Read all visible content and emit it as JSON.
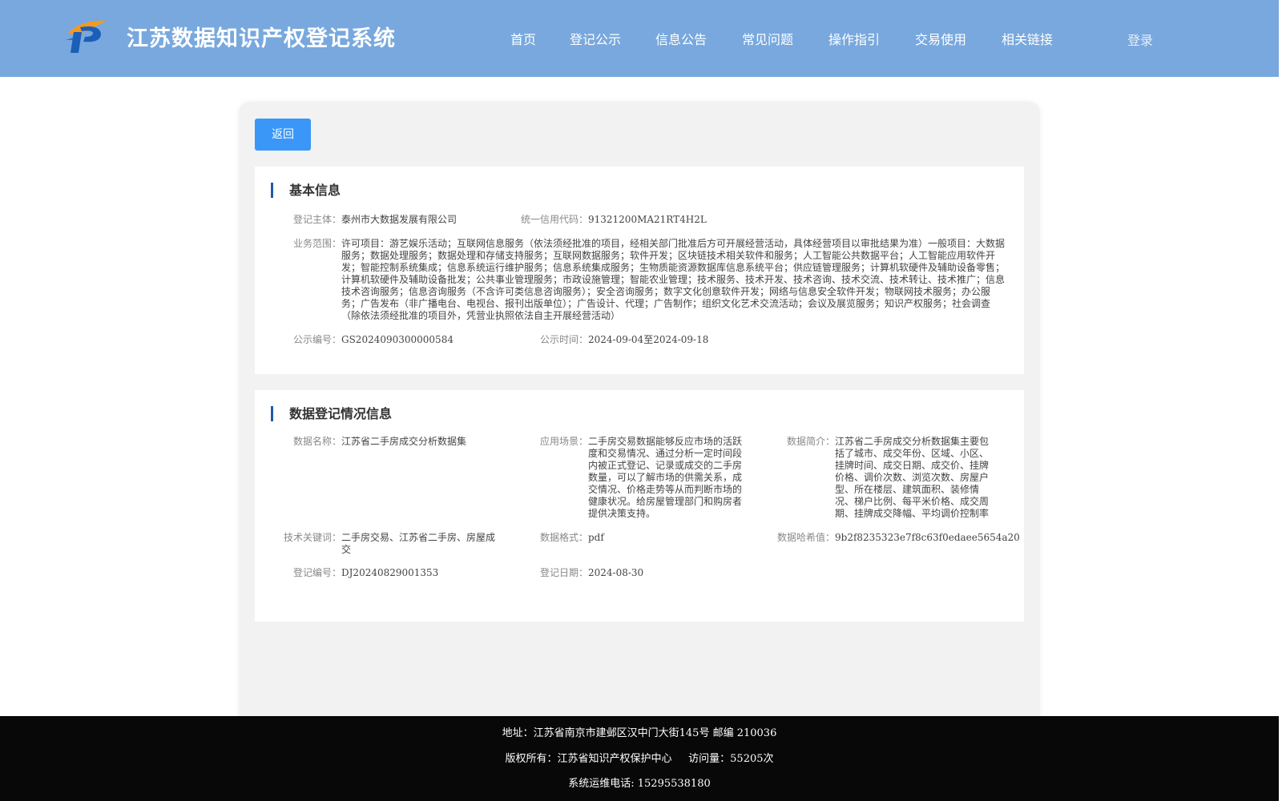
{
  "header": {
    "title": "江苏数据知识产权登记系统",
    "nav": [
      "首页",
      "登记公示",
      "信息公告",
      "常见问题",
      "操作指引",
      "交易使用",
      "相关链接"
    ],
    "login": "登录",
    "bg_color": "#78a8de"
  },
  "back_button": "返回",
  "basic": {
    "section_title": "基本信息",
    "subject_label": "登记主体：",
    "subject_value": "泰州市大数据发展有限公司",
    "credit_label": "统一信用代码：",
    "credit_value": "91321200MA21RT4H2L",
    "scope_label": "业务范围：",
    "scope_value": "许可项目：游艺娱乐活动；互联网信息服务（依法须经批准的项目，经相关部门批准后方可开展经营活动，具体经营项目以审批结果为准）一般项目：大数据服务；数据处理服务；数据处理和存储支持服务；互联网数据服务；软件开发；区块链技术相关软件和服务；人工智能公共数据平台；人工智能应用软件开发；智能控制系统集成；信息系统运行维护服务；信息系统集成服务；生物质能资源数据库信息系统平台；供应链管理服务；计算机软硬件及辅助设备零售；计算机软硬件及辅助设备批发；公共事业管理服务；市政设施管理；智能农业管理；技术服务、技术开发、技术咨询、技术交流、技术转让、技术推广；信息技术咨询服务；信息咨询服务（不含许可类信息咨询服务）；安全咨询服务；数字文化创意软件开发；网络与信息安全软件开发；物联网技术服务；办公服务；广告发布（非广播电台、电视台、报刊出版单位）；广告设计、代理；广告制作；组织文化艺术交流活动；会议及展览服务；知识产权服务；社会调查（除依法须经批准的项目外，凭营业执照依法自主开展经营活动）",
    "pub_no_label": "公示编号：",
    "pub_no_value": "GS2024090300000584",
    "pub_time_label": "公示时间：",
    "pub_time_value": "2024-09-04至2024-09-18"
  },
  "data_reg": {
    "section_title": "数据登记情况信息",
    "name_label": "数据名称：",
    "name_value": "江苏省二手房成交分析数据集",
    "scene_label": "应用场景：",
    "scene_value": "二手房交易数据能够反应市场的活跃度和交易情况、通过分析一定时间段内被正式登记、记录或成交的二手房数量，可以了解市场的供需关系，成交情况、价格走势等从而判断市场的健康状况。给房屋管理部门和购房者提供决策支持。",
    "intro_label": "数据简介：",
    "intro_value": "江苏省二手房成交分析数据集主要包括了城市、成交年份、区域、小区、挂牌时间、成交日期、成交价、挂牌价格、调价次数、浏览次数、房屋户型、所在楼层、建筑面积、装修情况、梯户比例、每平米价格、成交周期、挂牌成交降幅、平均调价控制率",
    "keywords_label": "技术关键词：",
    "keywords_value": "二手房交易、江苏省二手房、房屋成交",
    "format_label": "数据格式：",
    "format_value": "pdf",
    "hash_label": "数据哈希值：",
    "hash_value": "9b2f8235323e7f8c63f0edaee5654a20",
    "reg_no_label": "登记编号：",
    "reg_no_value": "DJ20240829001353",
    "reg_date_label": "登记日期：",
    "reg_date_value": "2024-08-30"
  },
  "footer": {
    "address": "地址：江苏省南京市建邺区汉中门大街145号 邮编 210036",
    "copyright": "版权所有：江苏省知识产权保护中心     访问量：55205次",
    "phone": "系统运维电话: 15295538180"
  }
}
